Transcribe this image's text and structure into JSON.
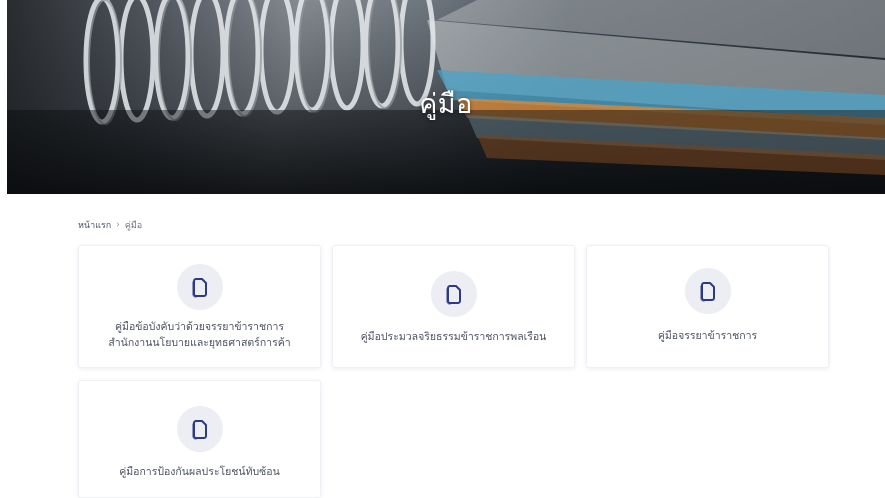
{
  "hero": {
    "title": "คู่มือ"
  },
  "breadcrumb": {
    "home": "หน้าแรก",
    "separator": "›",
    "current": "คู่มือ"
  },
  "cards": [
    {
      "line1": "คู่มือข้อบังคับว่าด้วยจรรยาข้าราชการ",
      "line2": "สำนักงานนโยบายและยุทธศาสตร์การค้า",
      "icon": "document-icon"
    },
    {
      "line1": "คู่มือประมวลจริยธรรมข้าราชการพลเรือน",
      "line2": "",
      "icon": "document-icon"
    },
    {
      "line1": "คู่มือจรรยาข้าราชการ",
      "line2": "",
      "icon": "document-icon"
    },
    {
      "line1": "คู่มือการป้องกันผลประโยชน์ทับซ้อน",
      "line2": "",
      "icon": "document-icon"
    }
  ],
  "colors": {
    "icon_stroke": "#2e3a86",
    "icon_bg": "#eceef4",
    "text": "#4b5160"
  }
}
